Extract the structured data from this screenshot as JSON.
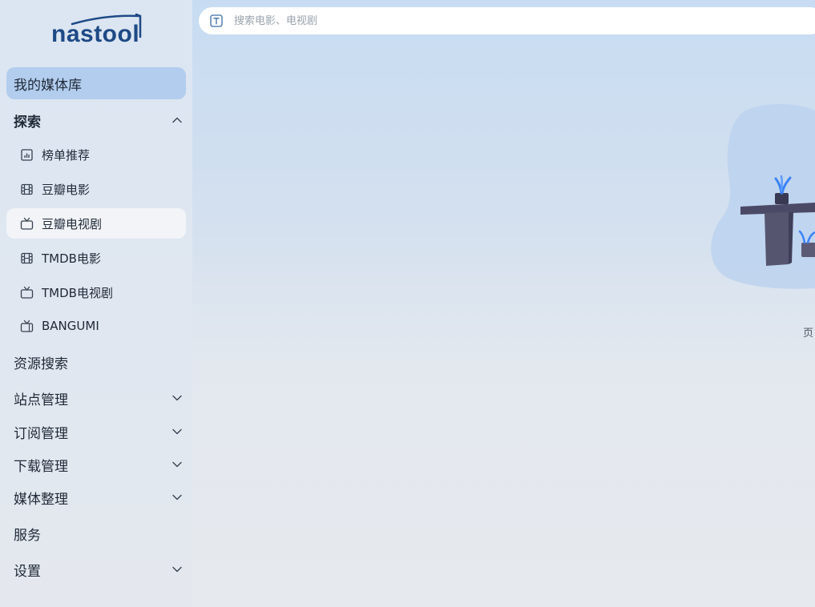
{
  "app": {
    "logo_text": "nastool",
    "brand_color": "#1e4a86",
    "accent_color": "#3b82f6"
  },
  "search": {
    "placeholder": "搜索电影、电视剧",
    "value": "",
    "icon": "text-t-icon"
  },
  "sidebar": {
    "library": {
      "label": "我的媒体库",
      "active": true
    },
    "explore": {
      "label": "探索",
      "expanded": true,
      "icon": "chevron-up-icon",
      "items": [
        {
          "label": "榜单推荐",
          "icon": "chart-icon"
        },
        {
          "label": "豆瓣电影",
          "icon": "film-icon"
        },
        {
          "label": "豆瓣电视剧",
          "icon": "tv-icon",
          "selected": true
        },
        {
          "label": "TMDB电影",
          "icon": "film-icon"
        },
        {
          "label": "TMDB电视剧",
          "icon": "tv-icon"
        },
        {
          "label": "BANGUMI",
          "icon": "tv-anime-icon"
        }
      ]
    },
    "resource_search": {
      "label": "资源搜索"
    },
    "site_management": {
      "label": "站点管理",
      "icon": "chevron-down-icon"
    },
    "subscription": {
      "label": "订阅管理",
      "icon": "chevron-down-icon"
    },
    "download": {
      "label": "下载管理",
      "icon": "chevron-down-icon"
    },
    "media_organize": {
      "label": "媒体整理",
      "icon": "chevron-down-icon"
    },
    "service": {
      "label": "服务"
    },
    "settings": {
      "label": "设置",
      "icon": "chevron-down-icon"
    }
  },
  "content": {
    "page_hint": "页"
  }
}
